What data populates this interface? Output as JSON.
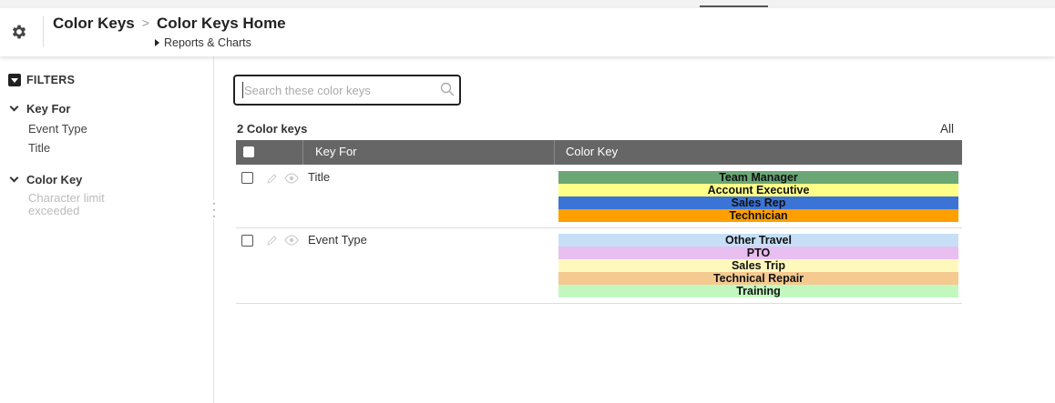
{
  "header": {
    "breadcrumb_root": "Color Keys",
    "breadcrumb_separator": ">",
    "page_title": "Color Keys Home",
    "sublink": "Reports & Charts"
  },
  "filters": {
    "heading": "FILTERS",
    "groups": [
      {
        "title": "Key For",
        "items": [
          "Event Type",
          "Title"
        ]
      },
      {
        "title": "Color Key",
        "items": [
          "Character limit exceeded"
        ]
      }
    ]
  },
  "search": {
    "placeholder": "Search these color keys",
    "value": ""
  },
  "list": {
    "count_label": "2 Color keys",
    "all_label": "All",
    "columns": [
      "Key For",
      "Color Key"
    ],
    "rows": [
      {
        "key_for": "Title",
        "colors": [
          {
            "label": "Team Manager",
            "color": "#6aa775"
          },
          {
            "label": "Account Executive",
            "color": "#ffff88"
          },
          {
            "label": "Sales Rep",
            "color": "#3b74d6"
          },
          {
            "label": "Technician",
            "color": "#ff9f00"
          }
        ]
      },
      {
        "key_for": "Event Type",
        "colors": [
          {
            "label": "Other Travel",
            "color": "#c6dff7"
          },
          {
            "label": "PTO",
            "color": "#e8bff0"
          },
          {
            "label": "Sales Trip",
            "color": "#fff8bd"
          },
          {
            "label": "Technical Repair",
            "color": "#f5ca90"
          },
          {
            "label": "Training",
            "color": "#c2f8c0"
          }
        ]
      }
    ]
  }
}
